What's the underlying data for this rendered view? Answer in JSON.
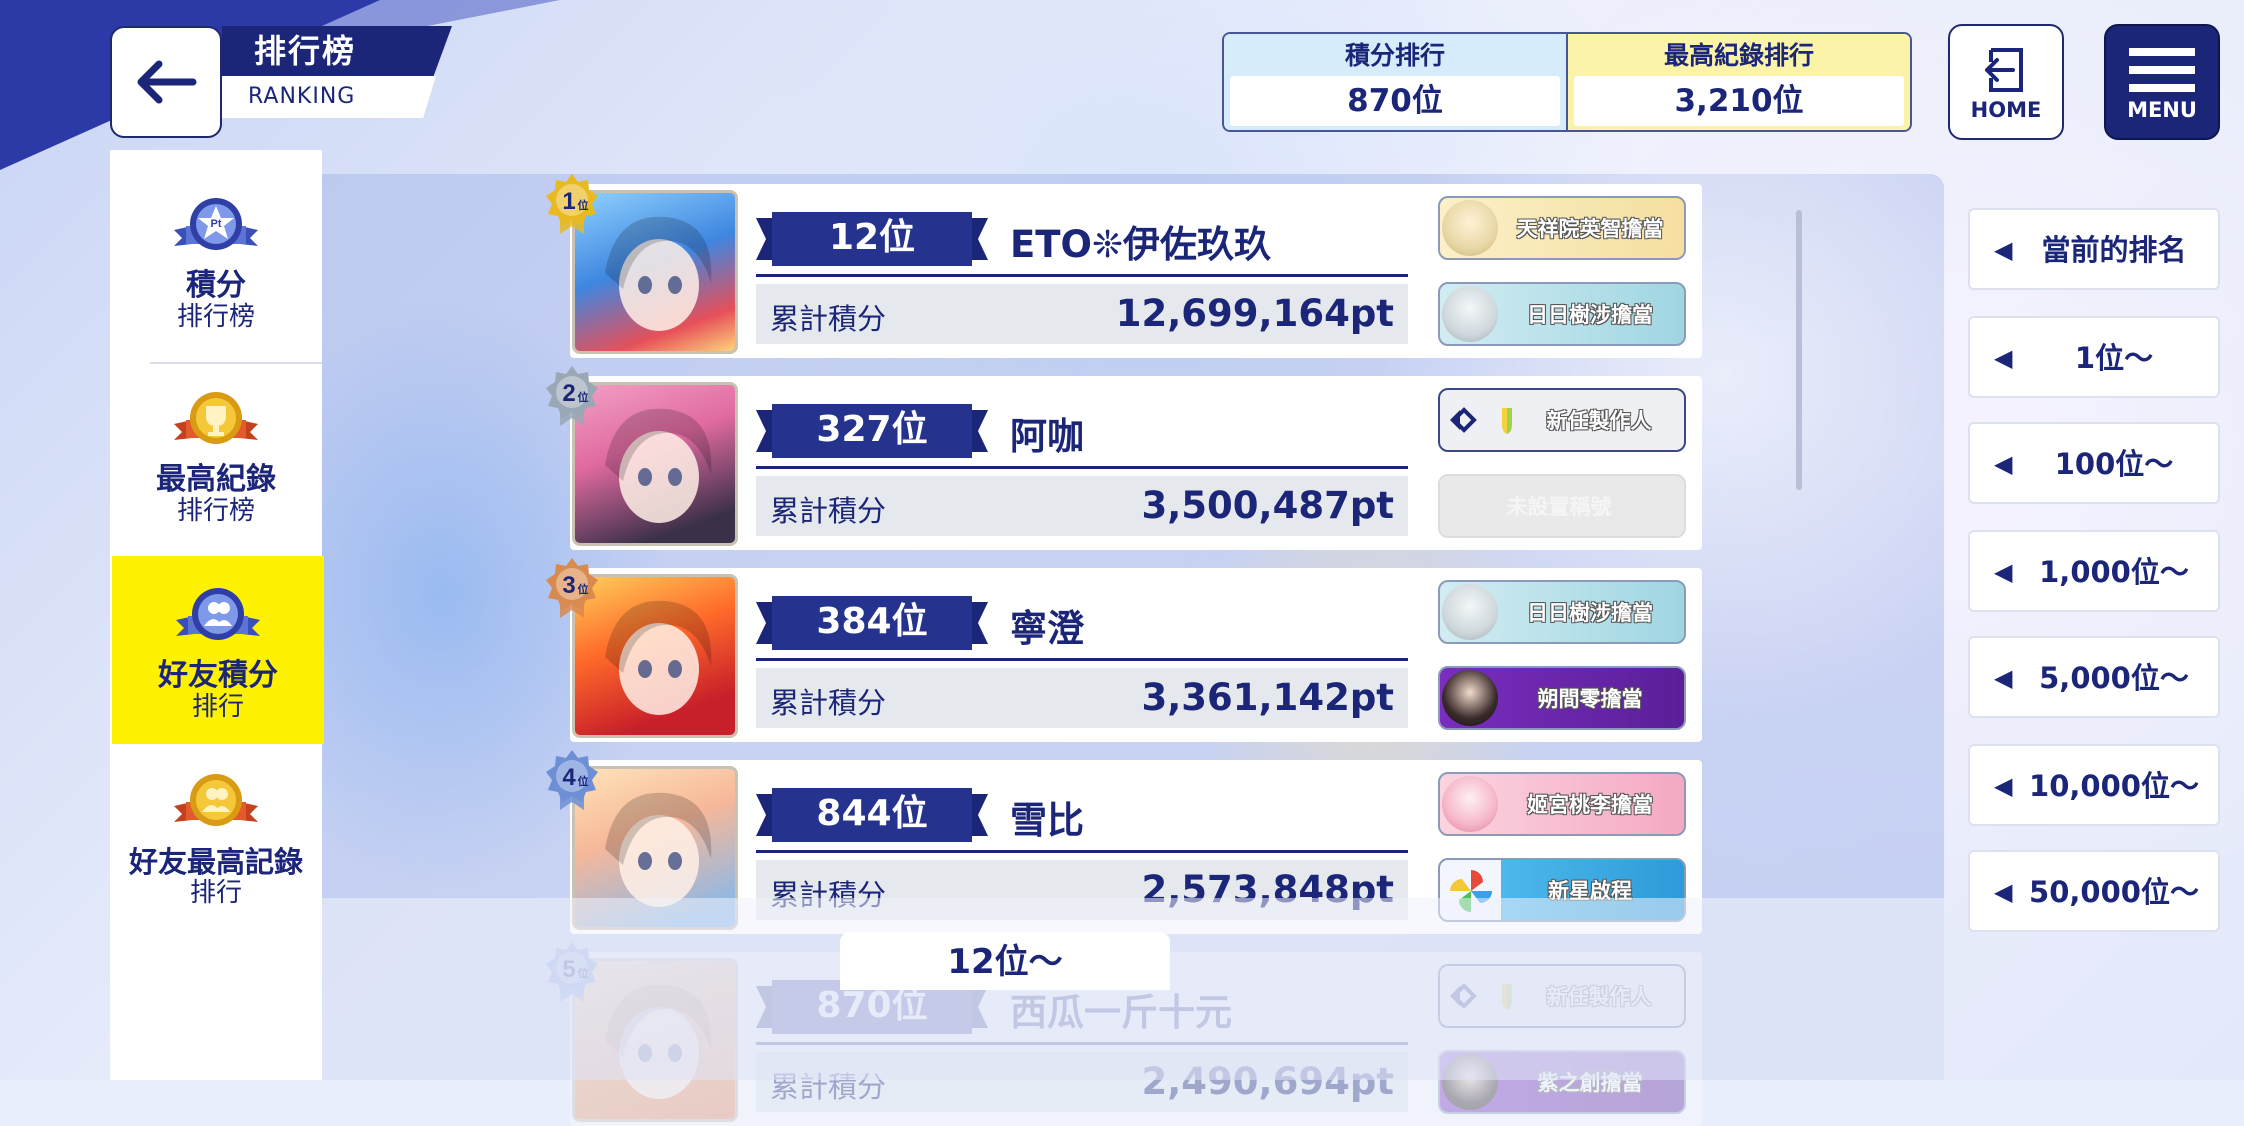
{
  "header": {
    "title": "排行榜",
    "subtitle": "RANKING",
    "summary": [
      {
        "caption": "積分排行",
        "value": "870位"
      },
      {
        "caption": "最高紀錄排行",
        "value": "3,210位"
      }
    ],
    "home_label": "HOME",
    "menu_label": "MENU"
  },
  "sidebar": {
    "items": [
      {
        "title": "積分",
        "sub": "排行榜",
        "badge": "Pt"
      },
      {
        "title": "最高紀錄",
        "sub": "排行榜",
        "badge": ""
      },
      {
        "title": "好友積分",
        "sub": "排行",
        "badge": ""
      },
      {
        "title": "好友最高記錄",
        "sub": "排行",
        "badge": ""
      }
    ]
  },
  "rows": [
    {
      "place": "1",
      "place_suffix": "位",
      "rank": "12位",
      "name": "ETO❊伊佐玖玖",
      "score_label": "累計積分",
      "score": "12,699,164pt",
      "tags": [
        "天祥院英智擔當",
        "日日樹涉擔當"
      ]
    },
    {
      "place": "2",
      "place_suffix": "位",
      "rank": "327位",
      "name": "阿咖",
      "score_label": "累計積分",
      "score": "3,500,487pt",
      "tags": [
        "新任製作人",
        "未設置稱號"
      ]
    },
    {
      "place": "3",
      "place_suffix": "位",
      "rank": "384位",
      "name": "寧澄",
      "score_label": "累計積分",
      "score": "3,361,142pt",
      "tags": [
        "日日樹涉擔當",
        "朔間零擔當"
      ]
    },
    {
      "place": "4",
      "place_suffix": "位",
      "rank": "844位",
      "name": "雪比",
      "score_label": "累計積分",
      "score": "2,573,848pt",
      "tags": [
        "姬宮桃李擔當",
        "新星啟程"
      ]
    },
    {
      "place": "5",
      "place_suffix": "位",
      "rank": "870位",
      "name": "西瓜一斤十元",
      "score_label": "累計積分",
      "score": "2,490,694pt",
      "tags": [
        "新任製作人",
        "紫之創擔當"
      ]
    }
  ],
  "page_label": "12位～",
  "jump_list": [
    "當前的排名",
    "1位～",
    "100位～",
    "1,000位～",
    "5,000位～",
    "10,000位～",
    "50,000位～"
  ],
  "colors": {
    "navy": "#1c2678",
    "active_tab": "#fff200",
    "gold": "#e8b920",
    "silver": "#9aa7b5",
    "bronze": "#d98a4e",
    "blue_badge": "#6c8fd6"
  }
}
